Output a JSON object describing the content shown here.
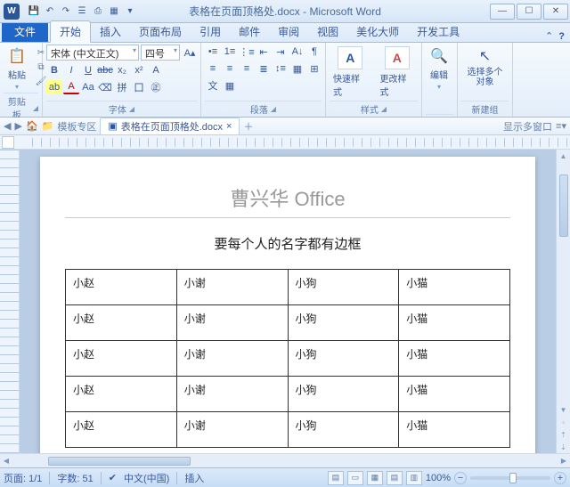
{
  "window": {
    "app_letter": "W",
    "doc_filename": "表格在页面顶格处.docx",
    "app_name": "Microsoft Word"
  },
  "qat": {
    "dropdown": "▾"
  },
  "tabs": {
    "file": "文件",
    "items": [
      "开始",
      "插入",
      "页面布局",
      "引用",
      "邮件",
      "审阅",
      "视图",
      "美化大师",
      "开发工具"
    ]
  },
  "ribbon": {
    "clipboard": {
      "paste": "粘贴",
      "label": "剪贴板"
    },
    "font": {
      "name": "宋体 (中文正文)",
      "size": "四号",
      "label": "字体"
    },
    "paragraph": {
      "label": "段落"
    },
    "styles": {
      "quick": "快速样式",
      "change": "更改样式",
      "label": "样式"
    },
    "editing": {
      "edit": "编辑"
    },
    "newgroup": {
      "select_multi": "选择多个对象",
      "label": "新建组"
    }
  },
  "breadcrumb": {
    "folder": "模板专区",
    "tab": "表格在页面顶格处.docx",
    "show_multi": "显示多窗口"
  },
  "document": {
    "title_left": "曹兴华 ",
    "title_right": "Office",
    "subtitle": "要每个人的名字都有边框",
    "rows": [
      [
        "小赵",
        "小谢",
        "小狗",
        "小猫"
      ],
      [
        "小赵",
        "小谢",
        "小狗",
        "小猫"
      ],
      [
        "小赵",
        "小谢",
        "小狗",
        "小猫"
      ],
      [
        "小赵",
        "小谢",
        "小狗",
        "小猫"
      ],
      [
        "小赵",
        "小谢",
        "小狗",
        "小猫"
      ]
    ]
  },
  "status": {
    "page": "页面: 1/1",
    "words": "字数: 51",
    "lang": "中文(中国)",
    "mode": "插入",
    "zoom": "100%",
    "minus": "−",
    "plus": "+"
  }
}
